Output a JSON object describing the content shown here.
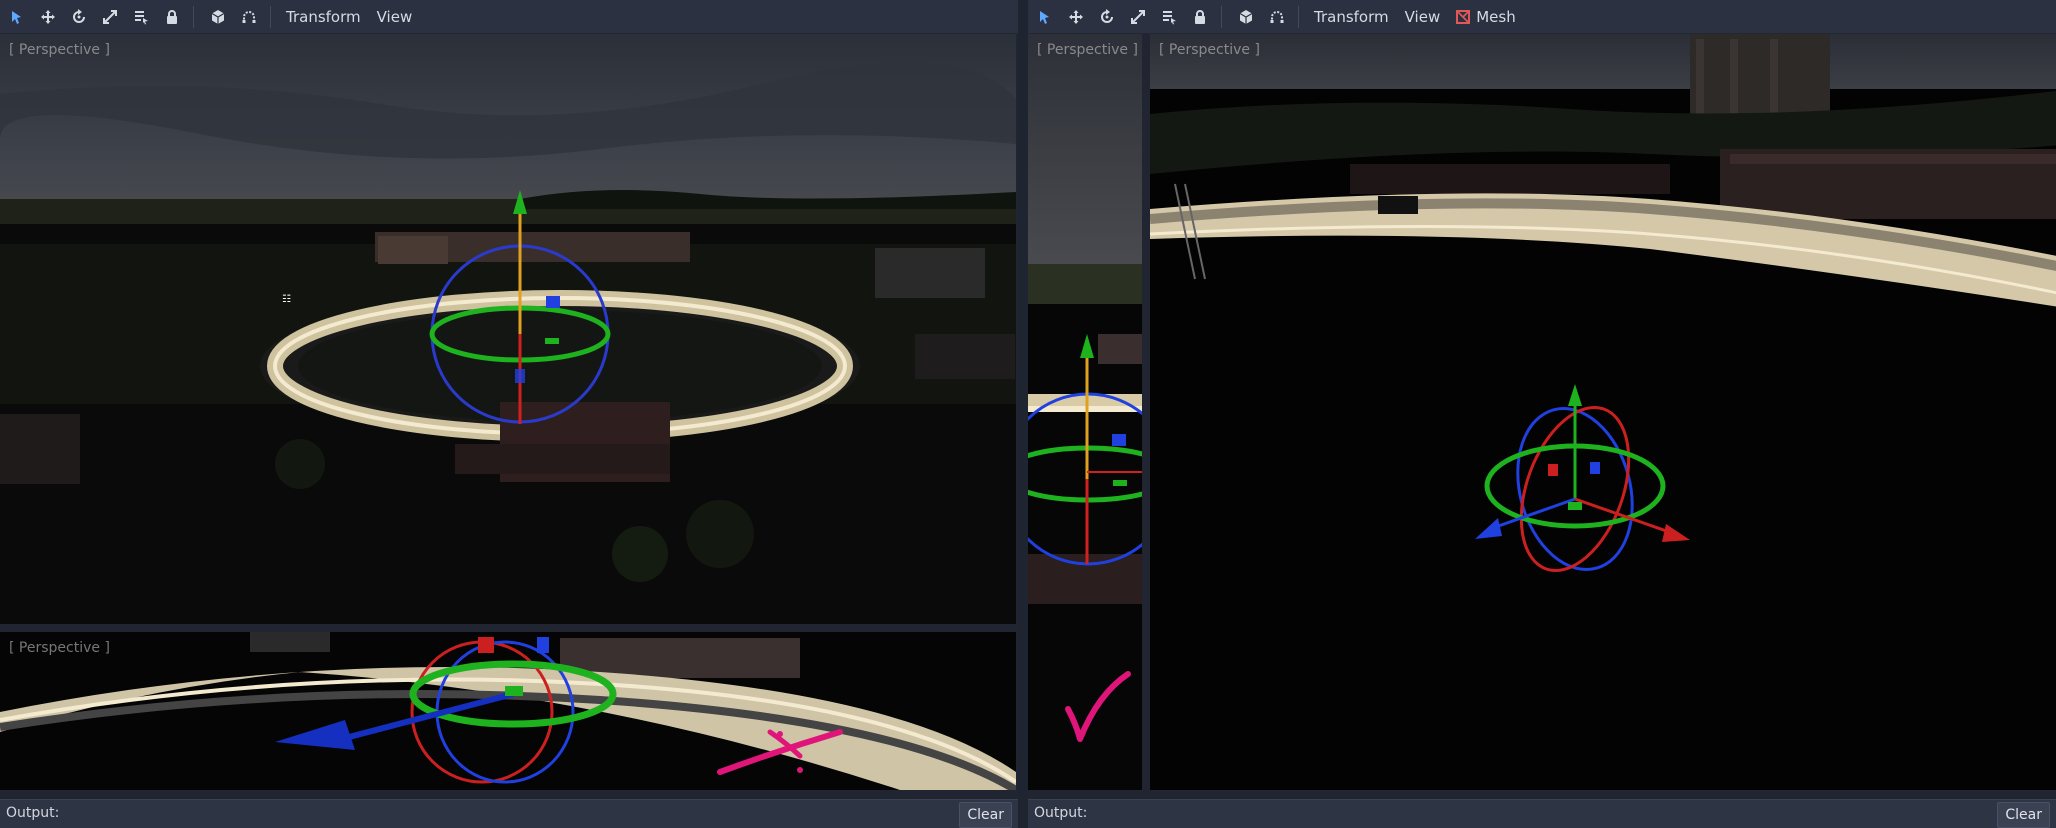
{
  "left_editor": {
    "toolbar": {
      "icons": [
        "select-icon",
        "move-icon",
        "rotate-icon",
        "scale-icon",
        "list-icon",
        "lock-icon",
        "cube-icon",
        "snap-icon"
      ],
      "menus": [
        "Transform",
        "View"
      ]
    },
    "viewports": [
      {
        "label": "[ Perspective ]"
      },
      {
        "label": "[ Perspective ]"
      }
    ],
    "output": {
      "label": "Output:",
      "clear": "Clear"
    }
  },
  "right_editor": {
    "toolbar": {
      "icons": [
        "select-icon",
        "move-icon",
        "rotate-icon",
        "scale-icon",
        "list-icon",
        "lock-icon",
        "cube-icon",
        "snap-icon"
      ],
      "menus": [
        "Transform",
        "View"
      ],
      "mesh_menu": "Mesh"
    },
    "viewports": [
      {
        "label": "[ Perspective ]"
      },
      {
        "label": "[ Perspective ]"
      }
    ],
    "output": {
      "label": "Output:",
      "clear": "Clear"
    }
  },
  "colors": {
    "accent": "#5fa8ff",
    "gizmo_x": "#e02020",
    "gizmo_y": "#1fb21f",
    "gizmo_z": "#2040e0",
    "annotation": "#e0157a",
    "mesh_icon": "#e05858"
  }
}
